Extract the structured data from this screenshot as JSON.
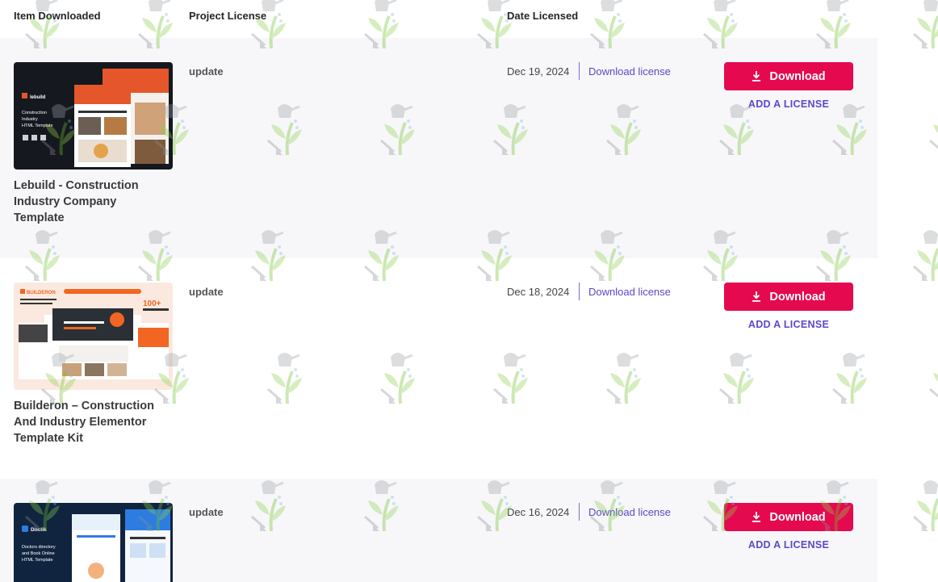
{
  "header": {
    "col_item": "Item Downloaded",
    "col_project": "Project License",
    "col_date": "Date Licensed"
  },
  "rows": [
    {
      "title": "Lebuild - Construction Industry Company Template",
      "project": "update",
      "date": "Dec 19, 2024",
      "link": "Download license",
      "button": "Download",
      "add": "ADD A LICENSE",
      "thumb": {
        "brand": "lebuild",
        "caption": "Construction Industry HTML Template",
        "bg": "#15181f",
        "accent": "#e5572b"
      }
    },
    {
      "title": "Builderon – Construction And Industry Elementor Template Kit",
      "project": "update",
      "date": "Dec 18, 2024",
      "link": "Download license",
      "button": "Download",
      "add": "ADD A LICENSE",
      "thumb": {
        "brand": "BUILDERON",
        "badge": "100+",
        "bg": "#fbe9df",
        "accent": "#f26522"
      }
    },
    {
      "title": "",
      "project": "update",
      "date": "Dec 16, 2024",
      "link": "Download license",
      "button": "Download",
      "add": "ADD A LICENSE",
      "thumb": {
        "brand": "Doclik",
        "caption": "Doctors directory and Book Online HTML Template",
        "bg": "#10243f",
        "accent": "#2d7de0"
      }
    }
  ]
}
